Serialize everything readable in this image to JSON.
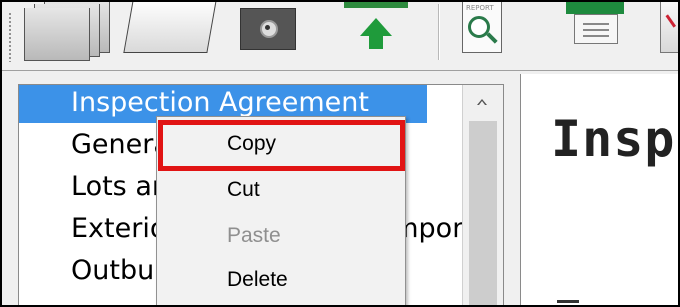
{
  "toolbar": {
    "buttons": [
      {
        "icon": "pages-stack-icon"
      },
      {
        "icon": "blank-sheet-icon"
      },
      {
        "icon": "camera-icon"
      },
      {
        "icon": "upload-arrow-icon"
      },
      {
        "icon": "report-search-icon",
        "label": "REPORT"
      },
      {
        "icon": "printer-icon"
      },
      {
        "icon": "export-icon"
      }
    ]
  },
  "tree": {
    "items": [
      {
        "label": "Inspection Agreement",
        "selected": true
      },
      {
        "label": "General Information",
        "selected": false
      },
      {
        "label": "Lots and Grounds",
        "selected": false
      },
      {
        "label": "Exterior Surface and Components",
        "selected": false
      },
      {
        "label": "Outbuildings",
        "selected": false
      }
    ]
  },
  "right_pane": {
    "title": "Insp"
  },
  "context_menu": {
    "items": [
      {
        "label": "Copy",
        "enabled": true,
        "highlighted": true
      },
      {
        "label": "Cut",
        "enabled": true
      },
      {
        "label": "Paste",
        "enabled": false
      },
      {
        "label": "Delete",
        "enabled": true
      }
    ]
  },
  "colors": {
    "selection": "#3c92e8",
    "highlight_border": "#e11414",
    "toolbar_green": "#1f9b3b"
  }
}
